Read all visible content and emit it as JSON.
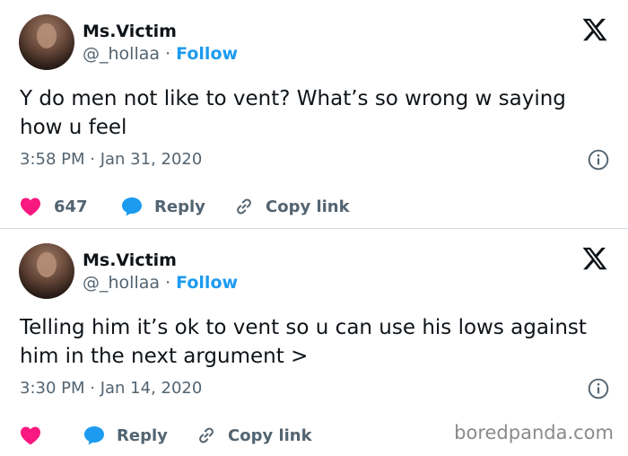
{
  "tweets": [
    {
      "author": {
        "name": "Ms.Victim",
        "handle": "@_hollaa",
        "separator": "·",
        "follow_label": "Follow"
      },
      "text": "Y do men not like to vent? What’s so wrong w saying how u feel",
      "timestamp": "3:58 PM · Jan 31, 2020",
      "likes": "647",
      "reply_label": "Reply",
      "copy_label": "Copy link"
    },
    {
      "author": {
        "name": "Ms.Victim",
        "handle": "@_hollaa",
        "separator": "·",
        "follow_label": "Follow"
      },
      "text": "Telling him it’s ok to vent so u can use his lows against him in the next argument >",
      "timestamp": "3:30 PM · Jan 14, 2020",
      "likes": "",
      "reply_label": "Reply",
      "copy_label": "Copy link"
    }
  ],
  "watermark": "boredpanda.com",
  "icons": {
    "logo": "x-logo-icon",
    "like": "heart-icon",
    "reply": "chat-bubble-icon",
    "copy": "link-icon",
    "info": "info-icon"
  },
  "colors": {
    "accent": "#1d9bf0",
    "like": "#f91880",
    "muted": "#536471",
    "text": "#0f1419"
  }
}
